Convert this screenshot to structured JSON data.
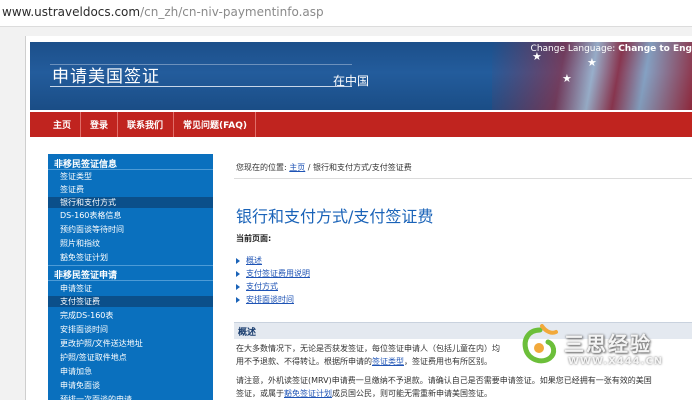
{
  "browser": {
    "url_host": "www.ustraveldocs.com",
    "url_path": "/cn_zh/cn-niv-paymentinfo.asp"
  },
  "header": {
    "title": "申请美国签证",
    "subtitle": "在中国",
    "change_language": "Change Language:",
    "change_language_link": "Change to Eng"
  },
  "nav": {
    "items": [
      "主页",
      "登录",
      "联系我们",
      "常见问题(FAQ)"
    ]
  },
  "sidebar": {
    "section1": {
      "heading": "非移民签证信息",
      "items": [
        "签证类型",
        "签证费",
        "银行和支付方式",
        "DS-160表格信息",
        "预约面谈等待时间",
        "照片和指纹",
        "豁免签证计划"
      ]
    },
    "section2": {
      "heading": "非移民签证申请",
      "items": [
        "申请签证",
        "支付签证费",
        "完成DS-160表",
        "安排面谈时间",
        "更改护照/文件送达地址",
        "护照/签证取件地点",
        "申请加急",
        "申请免面谈",
        "预排一次面谈的申请"
      ]
    }
  },
  "content": {
    "breadcrumb_prefix": "您现在的位置: ",
    "breadcrumb_home": "主页",
    "breadcrumb_rest": " / 银行和支付方式/支付签证费",
    "page_title": "银行和支付方式/支付签证费",
    "current_page_label": "当前页面:",
    "toc": [
      "概述",
      "支付签证费用说明",
      "支付方式",
      "安排面谈时间"
    ],
    "overview_title": "概述",
    "para1_line1": "在大多数情况下，无论是否获发签证，每位签证申请人（包括儿童在内）均",
    "para1_line2_a": "用不予退款、不得转让。根据所申请的",
    "para1_line2_link": "签证类型",
    "para1_line2_b": "，签证费用也有所区别。",
    "para2_line1": "请注意，外机读签证(MRV)申请费一旦缴纳不予退款。请确认自己是否需要申请签证。如果您已经拥有一张有效的美国",
    "para2_line2_a": "签证，或属于",
    "para2_line2_link": "豁免签证计划",
    "para2_line2_b": "成员国公民，则可能无需重新申请美国签证。"
  },
  "watermark": {
    "title": "三思经验",
    "url": "WWW.X444.CN"
  },
  "colors": {
    "banner_blue": "#235c9c",
    "nav_red": "#c0241f",
    "sidebar_blue": "#0a70be",
    "title_blue": "#1a63b8"
  }
}
